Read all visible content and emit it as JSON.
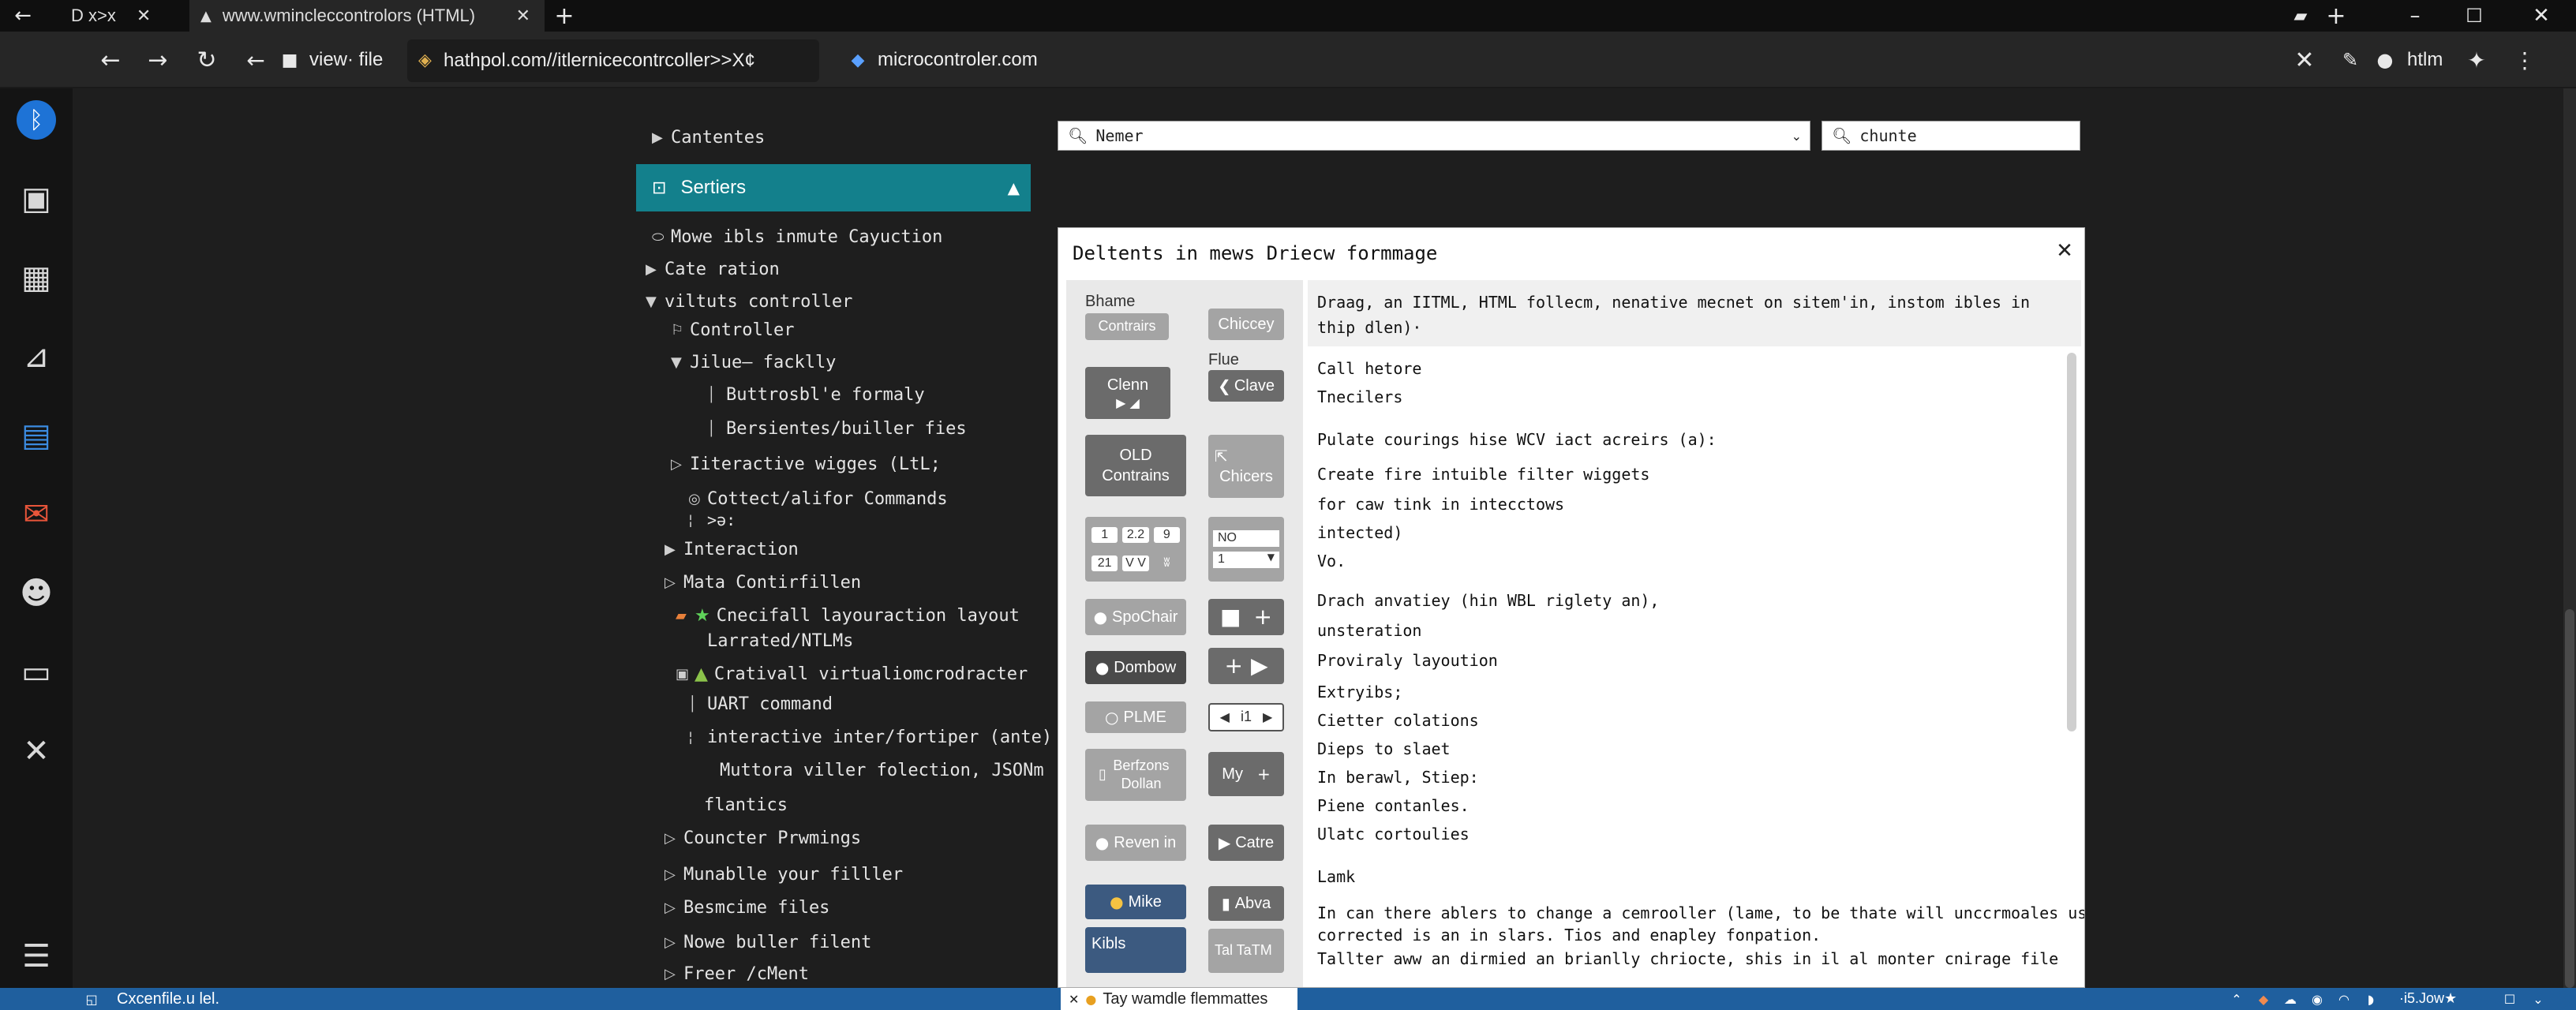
{
  "browser": {
    "tabs": [
      {
        "title": "D x>x"
      },
      {
        "title": "www.wmincleccontrolors (HTML)"
      }
    ],
    "toolbar": {
      "view_file": "view· file",
      "address": "hathpol.com//itlernicecontrcoller>>X¢",
      "third_url": "microcontroler.com",
      "right_label": "htlm"
    }
  },
  "explorer": {
    "contents_label": "Cantentes",
    "section_header": "Sertiers",
    "items": [
      "Mowe ibls inmute Cayuction",
      "Cate ration",
      "viltuts controller",
      "Controller",
      "Jilue– facklly",
      "Buttrosbl'e formaly",
      "Bersientes/builler fies",
      "Iiteractive wigges (LtL;",
      "Cottect/alifor Commands",
      ">ǝ:",
      "Interaction",
      "Mata Contirfillen",
      "Cnecifall layouraction layout",
      "Larrated/NTLMs",
      "Crativall virtualiomcrodracter",
      "UART command",
      "interactive inter/fortiper (ante)",
      "Muttora viller folection, JSONm",
      "flantics",
      "Councter Prwmings",
      "Munablle your filller",
      "Besmcime files",
      "Nowe buller filent",
      "Freer /cMent"
    ]
  },
  "search": {
    "name_value": "Nemer",
    "second_value": "chunte"
  },
  "panel": {
    "title": "Deltents in mews Driecw formmage",
    "toolbox": {
      "bhame_label": "Bhame",
      "contrairs": "Contrairs",
      "chiccey": "Chiccey",
      "flue_label": "Flue",
      "clenn": "Clenn",
      "clave": "Clave",
      "old_contrains": "OLD Contrains",
      "chicers": "Chicers",
      "grid_cells": [
        "1",
        "2.2",
        "9",
        "21",
        "V V",
        "ʬ"
      ],
      "no_label": "NO",
      "one_label": "1",
      "spochair": "SpoChair",
      "dombow": "Dombow",
      "plme": "PLME",
      "stepper_value": "i1",
      "berfzons_dollan": "Berfzons Dollan",
      "my": "My",
      "reven_in": "Reven in",
      "catre": "Catre",
      "mike": "Mike",
      "abva": "Abva",
      "kibls": "Kibls",
      "tal_tatm": "Tal TaTM"
    },
    "intro": "Draag, an IITML, HTML follecm, nenative mecnet on sitem'in, instom ibles in thip dlen)·",
    "lines": [
      "Call hetore",
      "Tnecilers",
      "Pulate courings hise WCV iact acreirs (a):",
      "Create fire intuible filter wiggets",
      "for caw tink in intecctows",
      "intected)",
      "Vo.",
      "Drach anvatiey (hin WBL riglety an),",
      "unsteration",
      "Proviraly layoution",
      "Extryibs;",
      "Cietter colations",
      "Dieps to slaet",
      "In berawl, Stiep:",
      "Piene contanles.",
      "Ulatc cortoulies",
      "Lamk",
      "In can there ablers to change a cemrooller (lame, to be thate will unccrmoales us",
      "corrected is an in slars. Tios and enapley fonpation.",
      "Tallter aww an dirmied an brianlly chriocte, shis in il al monter cnirage file"
    ]
  },
  "statusbar": {
    "left": "Cxcenfile.u lel.",
    "center": "Tay wamdle flemmattes",
    "right": "·i5.Jow★"
  },
  "colors": {
    "accent_teal": "#13808c",
    "statusbar_blue": "#1f5f9e",
    "bluetooth_blue": "#1e73d6"
  }
}
